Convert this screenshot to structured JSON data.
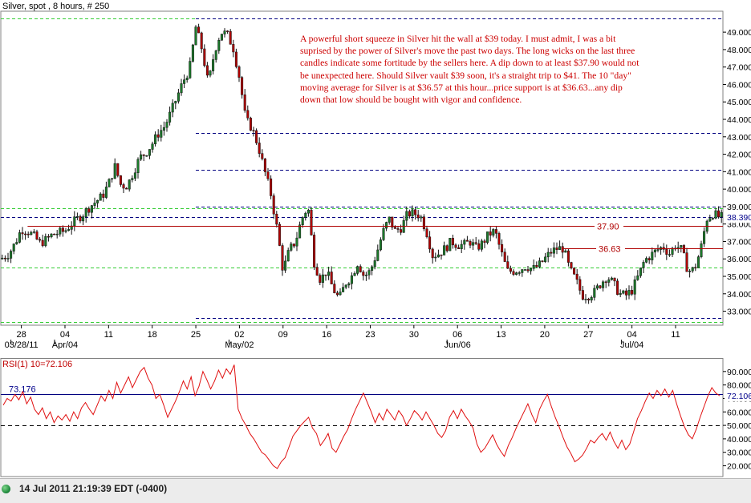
{
  "header": {
    "title": "Silver, spot , 8 hours, # 250"
  },
  "annotation": {
    "text": "A powerful short squeeze in Silver hit the wall at $39 today.  I must admit, I was a bit suprised by the power of Silver's move the past two days.  The long wicks on the last three candles indicate some fortitude by the sellers here.  A dip down to at least $37.90 would not be unexpected here.  Should Silver vault $39 soon, it's a straight trip to $41.  The 10 \"day\" moving average for Silver is at $36.57 at this hour...price support is at $36.63...any dip down that low should be bought with vigor and confidence."
  },
  "status": {
    "text": "14 Jul 2011 21:19:39  EDT (-0400)"
  },
  "colors": {
    "up": "#1b7a2a",
    "down": "#b00000",
    "green_dash": "#33cc33",
    "navy_dash": "#000080",
    "level": "#b00000",
    "rsi": "#e01010"
  },
  "chart_data": [
    {
      "type": "candlestick",
      "title": "Silver, spot , 8 hours, # 250",
      "ylim": [
        32.2,
        50.2
      ],
      "yticks": [
        33,
        34,
        35,
        36,
        37,
        38,
        39,
        40,
        41,
        42,
        43,
        44,
        45,
        46,
        47,
        48,
        49
      ],
      "ytick_labels": [
        "33.000",
        "34.000",
        "35.000",
        "36.000",
        "37.000",
        "38.000",
        "39.000",
        "40.000",
        "41.000",
        "42.000",
        "43.000",
        "44.000",
        "45.000",
        "46.000",
        "47.000",
        "48.000",
        "49.000"
      ],
      "xticks": [
        {
          "label": "28",
          "day": 0
        },
        {
          "label": "04",
          "day": 7
        },
        {
          "label": "11",
          "day": 14
        },
        {
          "label": "18",
          "day": 21
        },
        {
          "label": "25",
          "day": 28
        },
        {
          "label": "02",
          "day": 35
        },
        {
          "label": "09",
          "day": 42
        },
        {
          "label": "16",
          "day": 49
        },
        {
          "label": "23",
          "day": 56
        },
        {
          "label": "30",
          "day": 63
        },
        {
          "label": "06",
          "day": 70
        },
        {
          "label": "13",
          "day": 77
        },
        {
          "label": "20",
          "day": 84
        },
        {
          "label": "27",
          "day": 91
        },
        {
          "label": "04",
          "day": 98
        },
        {
          "label": "11",
          "day": 105
        }
      ],
      "xmajor": [
        {
          "label": "03/28/11",
          "day": 0
        },
        {
          "label": "Apr/04",
          "day": 7
        },
        {
          "label": "May/02",
          "day": 35
        },
        {
          "label": "Jun/06",
          "day": 70
        },
        {
          "label": "Jul/04",
          "day": 98
        }
      ],
      "day_range": [
        -3.3,
        112.6
      ],
      "price_path": [
        [
          -3.3,
          36.0
        ],
        [
          -2,
          36.3
        ],
        [
          -1,
          36.9
        ],
        [
          0,
          37.7
        ],
        [
          1,
          37.6
        ],
        [
          2,
          37.3
        ],
        [
          3,
          36.9
        ],
        [
          4,
          37.1
        ],
        [
          5,
          37.4
        ],
        [
          6,
          37.5
        ],
        [
          7,
          37.6
        ],
        [
          8,
          38.0
        ],
        [
          9,
          38.3
        ],
        [
          10,
          38.6
        ],
        [
          11,
          39.0
        ],
        [
          12,
          39.3
        ],
        [
          13,
          39.6
        ],
        [
          14,
          40.3
        ],
        [
          15,
          41.3
        ],
        [
          16,
          40.2
        ],
        [
          17,
          40.2
        ],
        [
          18,
          41.0
        ],
        [
          19,
          41.8
        ],
        [
          20,
          42.1
        ],
        [
          21,
          42.6
        ],
        [
          22,
          43.2
        ],
        [
          23,
          43.6
        ],
        [
          24,
          44.4
        ],
        [
          25,
          45.3
        ],
        [
          26,
          46.2
        ],
        [
          27,
          46.9
        ],
        [
          28,
          49.3
        ],
        [
          29,
          48.0
        ],
        [
          30,
          46.0
        ],
        [
          31,
          47.9
        ],
        [
          32,
          49.0
        ],
        [
          33,
          48.9
        ],
        [
          34,
          48.1
        ],
        [
          35,
          46.4
        ],
        [
          36,
          44.0
        ],
        [
          37,
          43.5
        ],
        [
          38,
          42.5
        ],
        [
          39,
          41.1
        ],
        [
          40,
          39.8
        ],
        [
          41,
          37.8
        ],
        [
          42,
          35.3
        ],
        [
          43,
          36.5
        ],
        [
          44,
          37.0
        ],
        [
          45,
          38.3
        ],
        [
          46,
          39.0
        ],
        [
          47,
          35.8
        ],
        [
          48,
          34.8
        ],
        [
          49,
          35.3
        ],
        [
          50,
          34.3
        ],
        [
          51,
          33.7
        ],
        [
          52,
          34.6
        ],
        [
          53,
          35.0
        ],
        [
          54,
          35.8
        ],
        [
          55,
          35.0
        ],
        [
          56,
          35.3
        ],
        [
          57,
          36.3
        ],
        [
          58,
          37.5
        ],
        [
          59,
          38.3
        ],
        [
          60,
          37.6
        ],
        [
          61,
          37.8
        ],
        [
          62,
          38.6
        ],
        [
          63,
          38.6
        ],
        [
          64,
          38.5
        ],
        [
          65,
          37.6
        ],
        [
          66,
          36.2
        ],
        [
          67,
          36.3
        ],
        [
          68,
          36.6
        ],
        [
          69,
          37.0
        ],
        [
          70,
          36.8
        ],
        [
          71,
          36.8
        ],
        [
          72,
          37.0
        ],
        [
          73,
          36.6
        ],
        [
          74,
          36.9
        ],
        [
          75,
          37.4
        ],
        [
          76,
          37.6
        ],
        [
          77,
          36.4
        ],
        [
          78,
          35.3
        ],
        [
          79,
          35.3
        ],
        [
          80,
          35.4
        ],
        [
          81,
          35.6
        ],
        [
          82,
          35.4
        ],
        [
          83,
          35.6
        ],
        [
          84,
          36.0
        ],
        [
          85,
          36.4
        ],
        [
          86,
          36.6
        ],
        [
          87,
          36.6
        ],
        [
          88,
          35.4
        ],
        [
          89,
          34.8
        ],
        [
          90,
          33.9
        ],
        [
          91,
          33.9
        ],
        [
          92,
          34.1
        ],
        [
          93,
          34.6
        ],
        [
          94,
          35.0
        ],
        [
          95,
          34.6
        ],
        [
          96,
          34.0
        ],
        [
          97,
          33.9
        ],
        [
          98,
          34.2
        ],
        [
          99,
          35.0
        ],
        [
          100,
          35.9
        ],
        [
          101,
          36.2
        ],
        [
          102,
          36.5
        ],
        [
          103,
          36.7
        ],
        [
          104,
          36.3
        ],
        [
          105,
          36.8
        ],
        [
          106,
          36.5
        ],
        [
          107,
          35.3
        ],
        [
          108,
          35.4
        ],
        [
          109,
          36.5
        ],
        [
          110,
          38.3
        ],
        [
          111,
          38.6
        ],
        [
          112,
          38.4
        ],
        [
          112.6,
          38.4
        ]
      ],
      "h_levels": [
        {
          "value": 49.8,
          "style": "green-dash",
          "from_day": -3.3,
          "to_day": 28
        },
        {
          "value": 49.8,
          "style": "navy-dash",
          "from_day": 28,
          "to_day": 112.6
        },
        {
          "value": 43.2,
          "style": "navy-dash",
          "from_day": 28,
          "to_day": 112.6
        },
        {
          "value": 41.1,
          "style": "navy-dash",
          "from_day": 28,
          "to_day": 112.6
        },
        {
          "value": 39.0,
          "style": "navy-dash",
          "from_day": 28,
          "to_day": 112.6
        },
        {
          "value": 38.9,
          "style": "green-dash",
          "from_day": -3.3,
          "to_day": 112.6
        },
        {
          "value": 38.39,
          "style": "navy-dash",
          "from_day": -3.3,
          "to_day": 112.6
        },
        {
          "value": 35.5,
          "style": "green-dash",
          "from_day": -3.3,
          "to_day": 112.6
        },
        {
          "value": 32.6,
          "style": "navy-dash",
          "from_day": 28,
          "to_day": 112.6
        },
        {
          "value": 32.4,
          "style": "green-dash",
          "from_day": -3.3,
          "to_day": 112.6
        }
      ],
      "price_levels": [
        {
          "value": 37.9,
          "label": "37.90",
          "from_day": 1.0
        },
        {
          "value": 36.63,
          "label": "36.63",
          "from_day": 87.0
        }
      ],
      "last_price": {
        "value": 38.39,
        "label": "38.390"
      }
    },
    {
      "type": "line",
      "title": "RSI(1) 10=72.106",
      "ylim": [
        12,
        100
      ],
      "yticks": [
        20,
        30,
        40,
        50,
        60,
        70,
        80,
        90
      ],
      "ytick_labels": [
        "20.000",
        "30.000",
        "40.000",
        "50.000",
        "60.000",
        "70.000",
        "80.000",
        "90.000"
      ],
      "reference_lines": [
        {
          "value": 73.176,
          "label": "73.176",
          "style": "navy-solid"
        },
        {
          "value": 50,
          "style": "black-dash"
        }
      ],
      "last_value": {
        "value": 72.106,
        "label": "72.106"
      },
      "values": [
        65,
        70,
        68,
        73,
        69,
        75,
        66,
        71,
        62,
        58,
        63,
        55,
        60,
        52,
        57,
        54,
        58,
        53,
        60,
        55,
        63,
        67,
        62,
        58,
        65,
        72,
        68,
        76,
        70,
        82,
        74,
        80,
        86,
        78,
        84,
        90,
        93,
        85,
        80,
        70,
        73,
        65,
        56,
        62,
        68,
        75,
        83,
        77,
        86,
        72,
        79,
        90,
        84,
        77,
        83,
        91,
        85,
        92,
        88,
        95,
        62,
        55,
        50,
        44,
        40,
        35,
        30,
        28,
        24,
        20,
        18,
        23,
        26,
        34,
        42,
        46,
        50,
        53,
        56,
        48,
        44,
        35,
        39,
        44,
        33,
        30,
        36,
        42,
        47,
        55,
        62,
        68,
        74,
        67,
        60,
        52,
        59,
        54,
        62,
        58,
        54,
        61,
        57,
        50,
        55,
        61,
        58,
        54,
        60,
        55,
        50,
        44,
        41,
        46,
        56,
        61,
        55,
        62,
        57,
        53,
        48,
        36,
        30,
        33,
        38,
        43,
        36,
        31,
        27,
        35,
        41,
        48,
        54,
        60,
        66,
        58,
        52,
        62,
        68,
        73,
        64,
        56,
        49,
        41,
        34,
        29,
        23,
        25,
        28,
        33,
        39,
        37,
        41,
        44,
        39,
        45,
        38,
        33,
        39,
        32,
        36,
        45,
        55,
        61,
        68,
        74,
        70,
        76,
        72,
        77,
        71,
        76,
        66,
        57,
        49,
        43,
        40,
        47,
        56,
        64,
        72,
        78,
        74,
        72
      ]
    }
  ]
}
